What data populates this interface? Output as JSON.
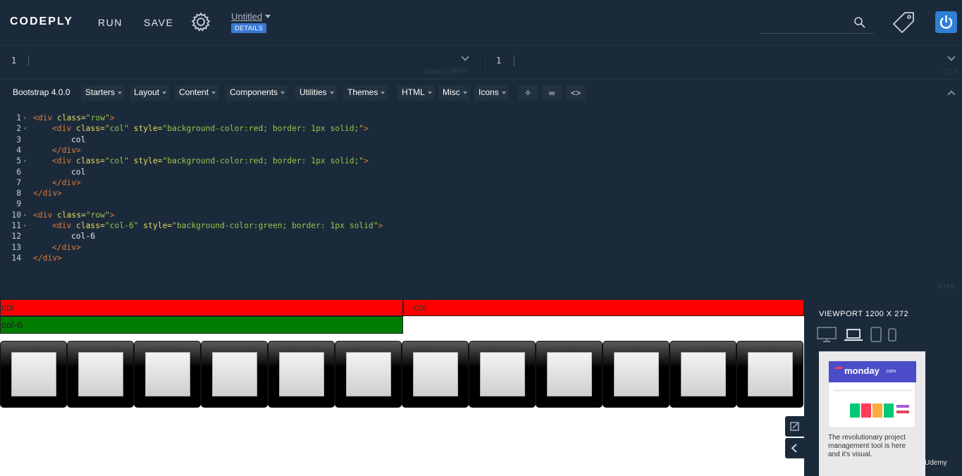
{
  "navbar": {
    "brand": "CODEPLY",
    "run_label": "RUN",
    "save_label": "SAVE",
    "project_title": "Untitled",
    "details_label": "DETAILS",
    "search_placeholder": ""
  },
  "editors": {
    "js": {
      "line_number": "1",
      "label": "JAVASCRIPT"
    },
    "css": {
      "line_number": "1",
      "label": "CSS"
    }
  },
  "toolbar": {
    "framework": "Bootstrap 4.0.0",
    "menus": [
      "Starters",
      "Layout",
      "Content",
      "Components",
      "Utilities",
      "Themes",
      "HTML",
      "Misc",
      "Icons"
    ],
    "icons": {
      "wand": "✧",
      "link": "∞",
      "code": "<>"
    }
  },
  "html_editor": {
    "label": "HTML",
    "lines": [
      {
        "n": "1",
        "fold": true,
        "indent": 0,
        "parts": [
          [
            "t",
            "<div "
          ],
          [
            "a",
            "class="
          ],
          [
            "s",
            "\"row\""
          ],
          [
            "t",
            ">"
          ]
        ]
      },
      {
        "n": "2",
        "fold": true,
        "indent": 1,
        "parts": [
          [
            "t",
            "<div "
          ],
          [
            "a",
            "class="
          ],
          [
            "s",
            "\"col\""
          ],
          [
            "a",
            " style="
          ],
          [
            "s",
            "\"background-color:red; border: 1px solid;\""
          ],
          [
            "t",
            ">"
          ]
        ]
      },
      {
        "n": "3",
        "fold": false,
        "indent": 2,
        "parts": [
          [
            "tx",
            "col"
          ]
        ]
      },
      {
        "n": "4",
        "fold": false,
        "indent": 1,
        "parts": [
          [
            "t",
            "</div>"
          ]
        ]
      },
      {
        "n": "5",
        "fold": true,
        "indent": 1,
        "parts": [
          [
            "t",
            "<div "
          ],
          [
            "a",
            "class="
          ],
          [
            "s",
            "\"col\""
          ],
          [
            "a",
            " style="
          ],
          [
            "s",
            "\"background-color:red; border: 1px solid;\""
          ],
          [
            "t",
            ">"
          ]
        ]
      },
      {
        "n": "6",
        "fold": false,
        "indent": 2,
        "parts": [
          [
            "tx",
            "col"
          ]
        ]
      },
      {
        "n": "7",
        "fold": false,
        "indent": 1,
        "parts": [
          [
            "t",
            "</div>"
          ]
        ]
      },
      {
        "n": "8",
        "fold": false,
        "indent": 0,
        "parts": [
          [
            "t",
            "</div>"
          ]
        ]
      },
      {
        "n": "9",
        "fold": false,
        "indent": 0,
        "parts": []
      },
      {
        "n": "10",
        "fold": true,
        "indent": 0,
        "parts": [
          [
            "t",
            "<div "
          ],
          [
            "a",
            "class="
          ],
          [
            "s",
            "\"row\""
          ],
          [
            "t",
            ">"
          ]
        ]
      },
      {
        "n": "11",
        "fold": true,
        "indent": 1,
        "parts": [
          [
            "t",
            "<div "
          ],
          [
            "a",
            "class="
          ],
          [
            "s",
            "\"col-6\""
          ],
          [
            "a",
            " style="
          ],
          [
            "s",
            "\"background-color:green; border: 1px solid\""
          ],
          [
            "t",
            ">"
          ]
        ]
      },
      {
        "n": "12",
        "fold": false,
        "indent": 2,
        "parts": [
          [
            "tx",
            "col-6"
          ]
        ]
      },
      {
        "n": "13",
        "fold": false,
        "indent": 1,
        "parts": [
          [
            "t",
            "</div>"
          ]
        ]
      },
      {
        "n": "14",
        "fold": false,
        "indent": 0,
        "parts": [
          [
            "t",
            "</div>"
          ]
        ]
      }
    ]
  },
  "preview": {
    "col_1": "col",
    "col_2": "col",
    "col_6": "col-6",
    "thumbnail_count": 12
  },
  "right_panel": {
    "viewport_label": "VIEWPORT 1200 X 272",
    "ad": {
      "brand": "monday",
      "brand_suffix": ".com",
      "text": "The revolutionary project management tool is here and it's visual."
    },
    "watermark": "Udemy"
  },
  "colors": {
    "background": "#1b2a3a",
    "red": "#ff0000",
    "green": "#007d00",
    "accent": "#2f7fd6"
  }
}
